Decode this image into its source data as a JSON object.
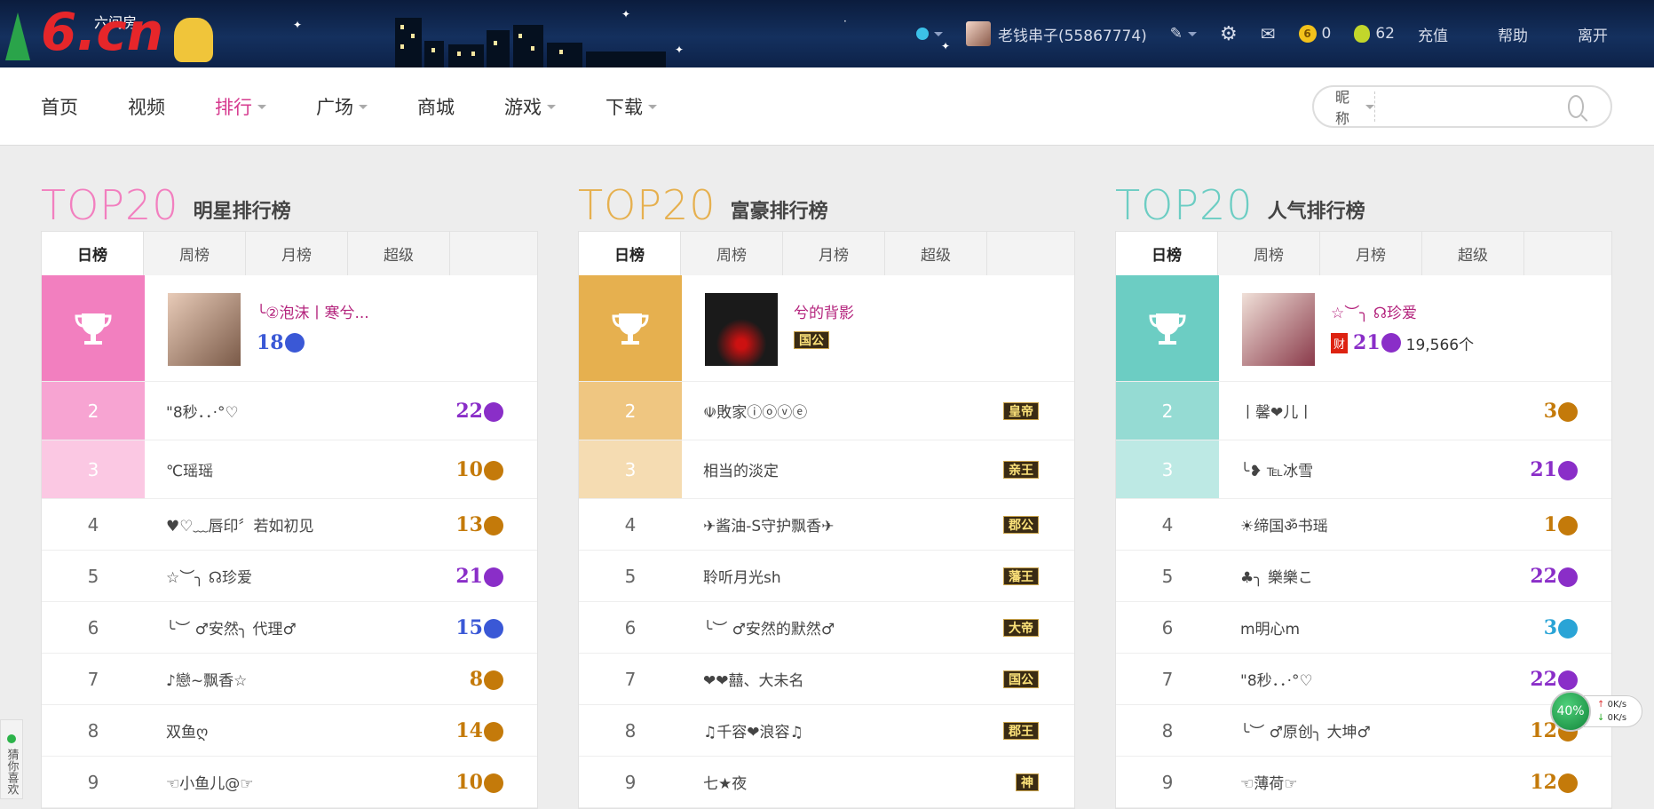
{
  "header": {
    "logo_text": "6.cn",
    "logo_sub": "六间房",
    "user_name": "老钱串子(55867774)",
    "coins": "0",
    "beans": "62",
    "links": [
      "充值",
      "帮助",
      "离开"
    ]
  },
  "nav": {
    "items": [
      "首页",
      "视频",
      "排行",
      "广场",
      "商城",
      "游戏",
      "下载"
    ],
    "active_index": 2,
    "search": {
      "type_label": "昵称",
      "placeholder": ""
    }
  },
  "boards": [
    {
      "top_label": "TOP20",
      "title": "明星排行榜",
      "color": "#f27fbf",
      "tabs": [
        "日榜",
        "周榜",
        "月榜",
        "超级"
      ],
      "first": {
        "name": "╰②泡沫丨寒兮...",
        "level": "18",
        "level_color": "#3a58d6",
        "extra": ""
      },
      "rows": [
        {
          "rank": "2",
          "name": "\"8秒．．·°♡",
          "level": "22",
          "level_color": "#8a2ec8"
        },
        {
          "rank": "3",
          "name": "℃瑶瑶",
          "level": "10",
          "level_color": "#c47a0a"
        },
        {
          "rank": "4",
          "name": "♥♡﹏唇印〞若如初见",
          "level": "13",
          "level_color": "#c47a0a"
        },
        {
          "rank": "5",
          "name": "☆︶╮ ☊珍爱",
          "level": "21",
          "level_color": "#8a2ec8"
        },
        {
          "rank": "6",
          "name": "╰︶   ♂安然╮ 代理♂",
          "level": "15",
          "level_color": "#3a58d6"
        },
        {
          "rank": "7",
          "name": "♪戀~飘香☆",
          "level": "8",
          "level_color": "#c47a0a"
        },
        {
          "rank": "8",
          "name": "双鱼ღ",
          "level": "14",
          "level_color": "#c47a0a"
        },
        {
          "rank": "9",
          "name": "☜小鱼儿@☞",
          "level": "10",
          "level_color": "#c47a0a"
        }
      ]
    },
    {
      "top_label": "TOP20",
      "title": "富豪排行榜",
      "color": "#e6b04f",
      "tabs": [
        "日榜",
        "周榜",
        "月榜",
        "超级"
      ],
      "first": {
        "name": "兮的背影",
        "badge": "国公",
        "extra": ""
      },
      "rows": [
        {
          "rank": "2",
          "name": "☫敗家ⓘⓞⓥⓔ",
          "badge": "皇帝"
        },
        {
          "rank": "3",
          "name": "相当的淡定",
          "badge": "亲王"
        },
        {
          "rank": "4",
          "name": "✈酱油-S守护飘香✈",
          "badge": "郡公"
        },
        {
          "rank": "5",
          "name": "聆听月光sh",
          "badge": "藩王"
        },
        {
          "rank": "6",
          "name": "╰︶   ♂安然的默然♂",
          "badge": "大帝"
        },
        {
          "rank": "7",
          "name": "❤❤囍、大未名",
          "badge": "国公"
        },
        {
          "rank": "8",
          "name": "♫千容❤浪容♫",
          "badge": "郡王"
        },
        {
          "rank": "9",
          "name": "七★夜",
          "badge": "神"
        }
      ]
    },
    {
      "top_label": "TOP20",
      "title": "人气排行榜",
      "color": "#6ccdc3",
      "tabs": [
        "日榜",
        "周榜",
        "月榜",
        "超级"
      ],
      "first": {
        "name": "☆︶╮ ☊珍爱",
        "level": "21",
        "level_color": "#8a2ec8",
        "extra": "19,566个",
        "icon_text": "财"
      },
      "rows": [
        {
          "rank": "2",
          "name": "丨馨❤儿丨",
          "level": "3",
          "level_color": "#c47a0a"
        },
        {
          "rank": "3",
          "name": "╰❥ ℡冰雪",
          "level": "21",
          "level_color": "#8a2ec8"
        },
        {
          "rank": "4",
          "name": "☀缔国ॐ书瑶",
          "level": "1",
          "level_color": "#c47a0a"
        },
        {
          "rank": "5",
          "name": "♣╮ 樂樂こ",
          "level": "22",
          "level_color": "#8a2ec8"
        },
        {
          "rank": "6",
          "name": "m明心m",
          "level": "3",
          "level_color": "#2aa4d6"
        },
        {
          "rank": "7",
          "name": "\"8秒．．·°♡",
          "level": "22",
          "level_color": "#8a2ec8"
        },
        {
          "rank": "8",
          "name": "╰︶   ♂原创╮ 大坤♂",
          "level": "12",
          "level_color": "#c47a0a"
        },
        {
          "rank": "9",
          "name": "☜薄荷☞",
          "level": "12",
          "level_color": "#c47a0a"
        }
      ]
    }
  ],
  "widgets": {
    "guess_label": "猜你喜欢",
    "speed_percent": "40%",
    "up_rate": "0K/s",
    "down_rate": "0K/s"
  }
}
